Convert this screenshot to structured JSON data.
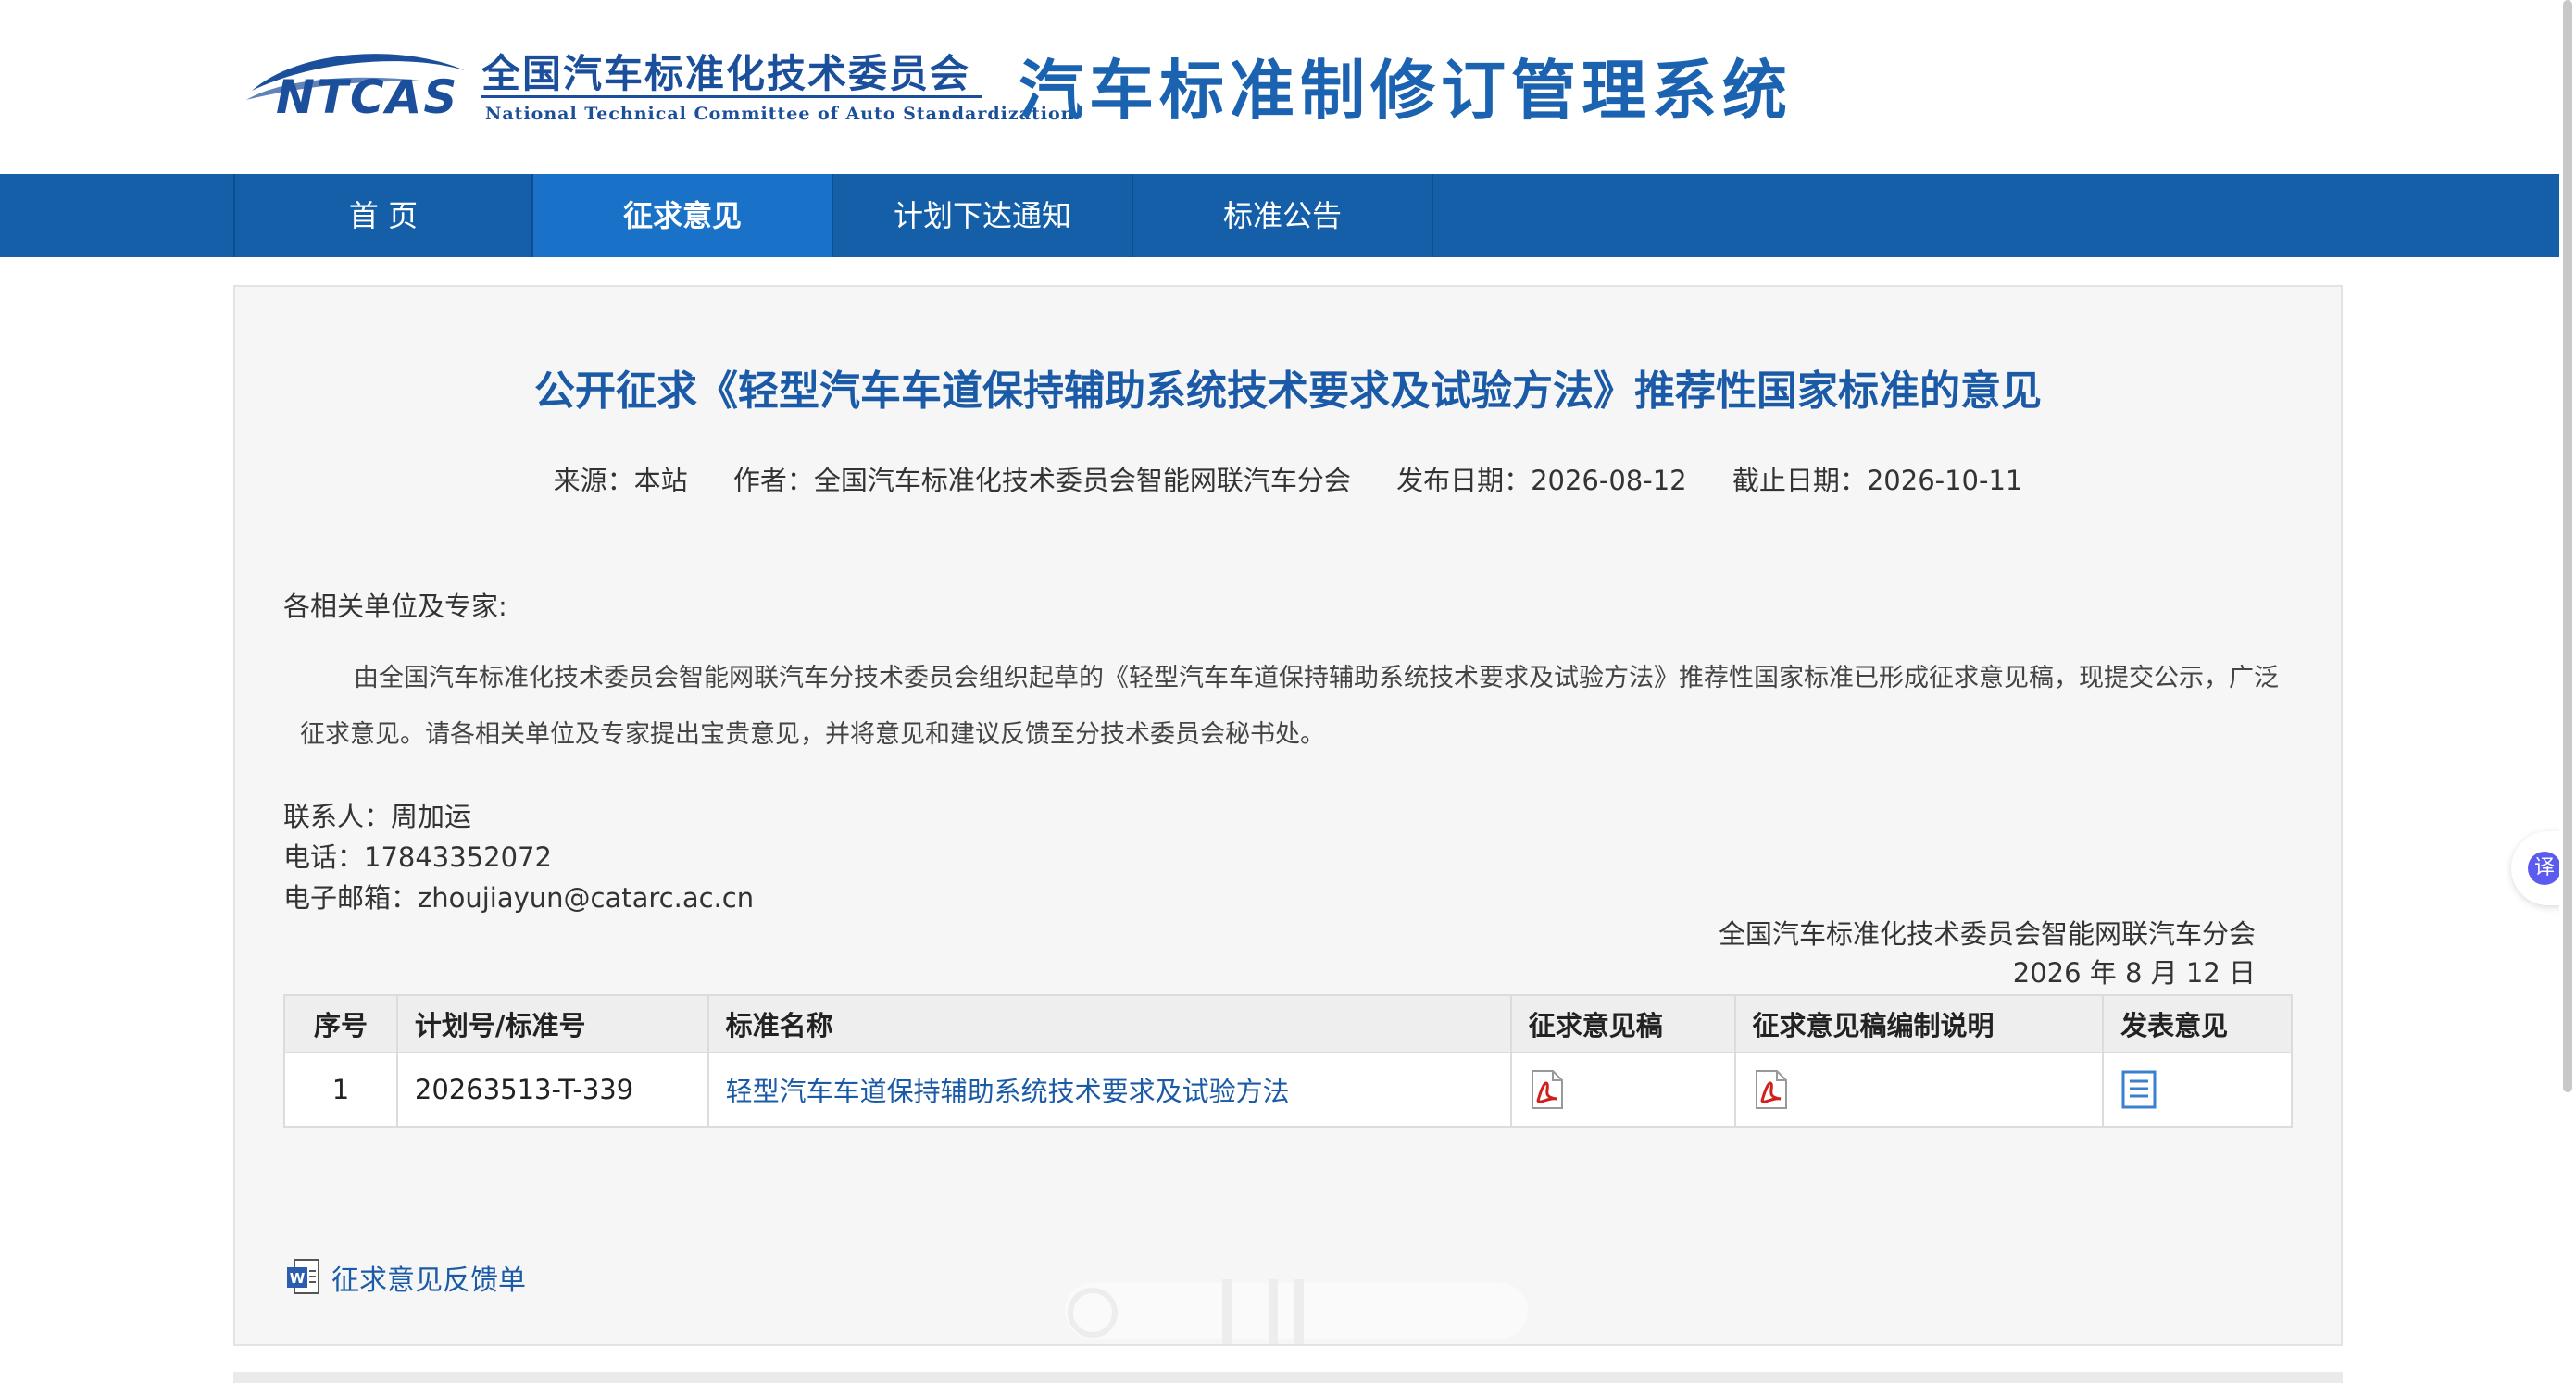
{
  "header": {
    "logo_text": "NTCAS",
    "org_name_cn": "全国汽车标准化技术委员会",
    "org_name_en": "National Technical Committee of Auto Standardization",
    "system_title": "汽车标准制修订管理系统"
  },
  "nav": {
    "items": [
      {
        "label": "首 页",
        "active": false
      },
      {
        "label": "征求意见",
        "active": true
      },
      {
        "label": "计划下达通知",
        "active": false
      },
      {
        "label": "标准公告",
        "active": false
      }
    ]
  },
  "article": {
    "title": "公开征求《轻型汽车车道保持辅助系统技术要求及试验方法》推荐性国家标准的意见",
    "meta": {
      "source": "来源：本站",
      "author": "作者：全国汽车标准化技术委员会智能网联汽车分会",
      "publish_date": "发布日期：2026-08-12",
      "deadline": "截止日期：2026-10-11"
    },
    "salutation": "各相关单位及专家:",
    "body": "由全国汽车标准化技术委员会智能网联汽车分技术委员会组织起草的《轻型汽车车道保持辅助系统技术要求及试验方法》推荐性国家标准已形成征求意见稿，现提交公示，广泛征求意见。请各相关单位及专家提出宝贵意见，并将意见和建议反馈至分技术委员会秘书处。",
    "contact": {
      "person": "联系人：周加运",
      "phone": "电话：17843352072",
      "email": "电子邮箱：zhoujiayun@catarc.ac.cn"
    },
    "signature": {
      "org": "全国汽车标准化技术委员会智能网联汽车分会",
      "date": "2026 年 8 月 12 日"
    }
  },
  "table": {
    "headers": [
      "序号",
      "计划号/标准号",
      "标准名称",
      "征求意见稿",
      "征求意见稿编制说明",
      "发表意见"
    ],
    "rows": [
      {
        "index": "1",
        "plan_no": "20263513-T-339",
        "name": "轻型汽车车道保持辅助系统技术要求及试验方法",
        "draft_icon": "pdf-icon",
        "explanation_icon": "pdf-icon",
        "comment_icon": "list-icon"
      }
    ]
  },
  "feedback": {
    "label": "征求意见反馈单",
    "icon": "word-document-icon"
  },
  "widgets": {
    "translate_label": "译"
  },
  "colors": {
    "nav_bg": "#155fa8",
    "nav_active": "#1a72c8",
    "title_blue": "#1a5aa6",
    "panel_bg": "#f6f6f6"
  }
}
